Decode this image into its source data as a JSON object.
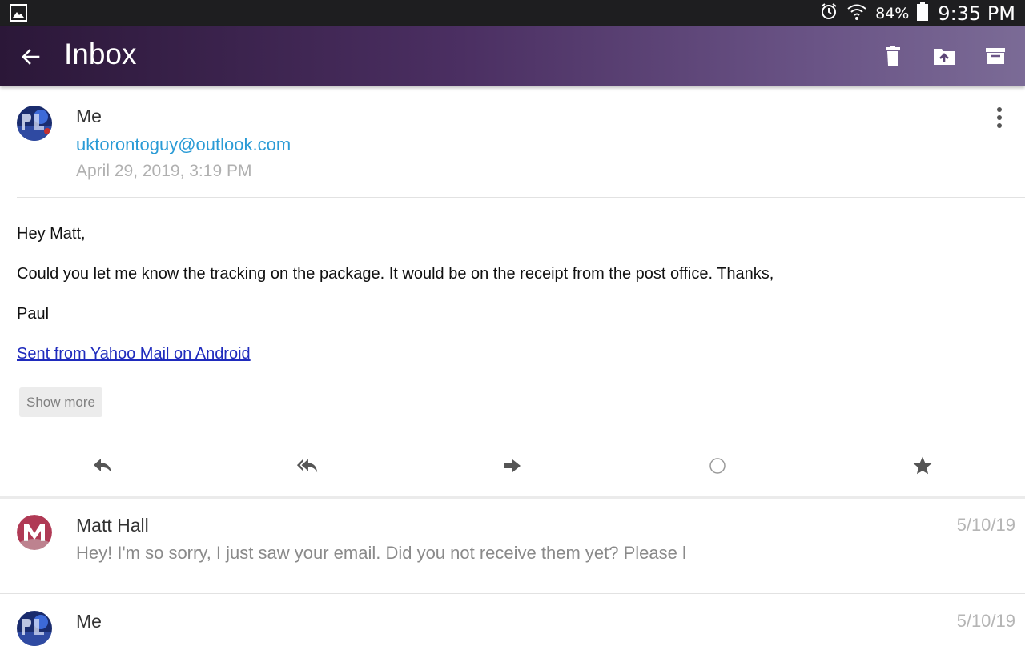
{
  "status_bar": {
    "battery": "84%",
    "time": "9:35 PM",
    "icons": [
      "gallery-icon",
      "alarm-icon",
      "wifi-icon",
      "battery-icon"
    ]
  },
  "app_bar": {
    "title": "Inbox",
    "actions": [
      "delete-icon",
      "move-to-folder-icon",
      "archive-icon"
    ]
  },
  "message": {
    "sender": "Me",
    "email": "uktorontoguy@outlook.com",
    "date": "April 29, 2019, 3:19 PM",
    "body": [
      "Hey Matt,",
      "Could you let me know the tracking on the package. It would be on the receipt from the post office.  Thanks,",
      "Paul"
    ],
    "signature_link": "Sent from Yahoo Mail on Android",
    "show_more_label": "Show more",
    "actions": [
      "reply-icon",
      "reply-all-icon",
      "forward-icon",
      "mark-unread-icon",
      "star-icon"
    ]
  },
  "thread": [
    {
      "sender": "Matt Hall",
      "date": "5/10/19",
      "snippet": "Hey! I'm so sorry, I just saw your email. Did you not receive them yet? Please l"
    },
    {
      "sender": "Me",
      "date": "5/10/19",
      "snippet": ""
    }
  ],
  "colors": {
    "app_bar_start": "#2b1738",
    "app_bar_end": "#7b6b96",
    "email_link": "#2a9bd6",
    "signature_link": "#1f2bbd"
  }
}
